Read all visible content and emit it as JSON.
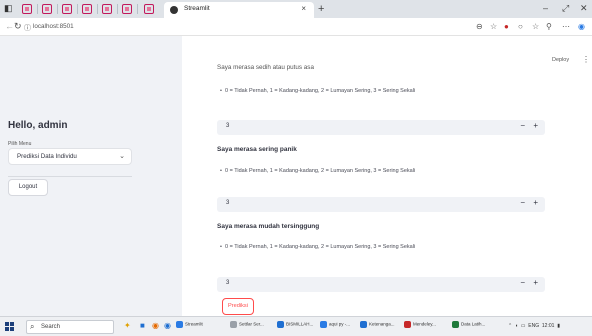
{
  "browser": {
    "tab_title": "Streamlit",
    "tab_close": "×",
    "new_tab": "+",
    "url": "localhost:8501",
    "win_minimize": "–",
    "win_maximize": "⤢",
    "win_close": "✕"
  },
  "sidebar": {
    "greeting": "Hello, admin",
    "menu_label": "Pilih Menu",
    "menu_selected": "Prediksi Data Individu",
    "logout": "Logout"
  },
  "header": {
    "deploy": "Deploy",
    "menu": "⋮"
  },
  "scale_legend": "0 = Tidak Pernah, 1 = Kadang-kadang, 2 = Lumayan Sering, 3 = Sering Sekali",
  "questions": [
    {
      "title": "Saya merasa sedih atau putus asa",
      "value": "3"
    },
    {
      "title": "Saya merasa sering panik",
      "value": "3"
    },
    {
      "title": "Saya merasa mudah tersinggung",
      "value": "3"
    }
  ],
  "stepper": {
    "minus": "−",
    "plus": "+"
  },
  "predict_button": "Prediksi",
  "taskbar": {
    "search": "Search",
    "apps": [
      "Streamlit",
      "Settlar Ser...",
      "BISMILLAH...",
      "aqui py -...",
      "Ketenanga...",
      "Mendeley...",
      "Data Latih..."
    ],
    "lang": "ENG",
    "time": "12:01"
  },
  "colors": {
    "accent": "#ff4b4b",
    "sidebar_bg": "#f0f2f6",
    "input_bg": "#f0f2f6"
  }
}
